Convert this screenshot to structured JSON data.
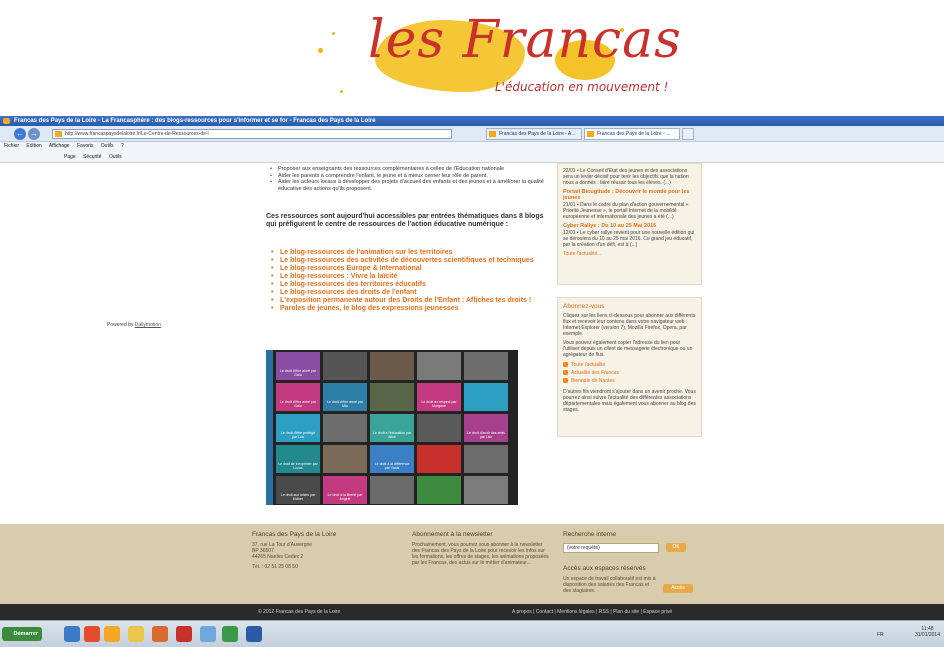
{
  "logo": {
    "brand": "les Francas",
    "tagline": "L'éducation en mouvement !"
  },
  "browser": {
    "title": "Francas des Pays de la Loire - La Francasphère : des blogs-ressources pour s'informer et se for - Francas des Pays de la Loire",
    "url": "http://www.francaspaysdelaloire.fr/Le-Centre-de-Ressources-de-l",
    "tabs": [
      {
        "label": "Francas des Pays de la Loire - A..."
      },
      {
        "label": "Francas des Pays de la Loire - ..."
      }
    ],
    "menu": [
      "Fichier",
      "Edition",
      "Affichage",
      "Favoris",
      "Outils",
      "?"
    ],
    "toolbar": [
      "Page",
      "Sécurité",
      "Outils"
    ]
  },
  "page": {
    "powered_by_prefix": "Powered by",
    "powered_by_link": "Dailymotion",
    "bullets": [
      "Proposer aux enseignants des ressources complémentaires à celles de l'Education nationale",
      "Aider les parents à comprendre l'enfant, le jeune et à mieux cerner leur rôle de parent.",
      "Aider les acteurs locaux à développer des projets d'accueil des enfants et des jeunes et à améliorer la qualité éducative des actions qu'ils proposent."
    ],
    "lead": "Ces ressources sont aujourd'hui accessibles par entrées thématiques dans 8 blogs qui préfigurent le centre de ressources de l'action éducative numérique :",
    "blog_links": [
      "Le blog-ressources de l'animation sur les territoires",
      "Le blog-ressources des activités de découvertes scientifiques et techniques",
      "Le blog-ressources Europe & International",
      "Le blog-ressources : Vivre la laïcité",
      "Le blog-ressources des territoires éducatifs",
      "Le blog-ressources des droits de l'enfant",
      "L'exposition permanente autour des Droits de l'Enfant : Affiches tes droits !",
      "Paroles de jeunes, le blog des expressions jeunesses"
    ],
    "video_brand": "Dailymotion",
    "video_tiles": [
      {
        "label": "Le droit d'être aimé",
        "by": "par Gaïa",
        "color": "#8a4fa3"
      },
      {
        "label": "",
        "by": "",
        "color": "#555"
      },
      {
        "label": "",
        "by": "",
        "color": "#6b5a48"
      },
      {
        "label": "",
        "by": "",
        "color": "#7a7a7a"
      },
      {
        "label": "",
        "by": "",
        "color": "#6d6d6d"
      },
      {
        "label": "Le droit d'être aimé",
        "by": "par Gaïa",
        "color": "#c23a7f"
      },
      {
        "label": "Le droit d'être aimé",
        "by": "par Mia",
        "color": "#2d7fa8"
      },
      {
        "label": "",
        "by": "",
        "color": "#596648"
      },
      {
        "label": "Le droit au respect",
        "by": "par Morgane",
        "color": "#c23a7f"
      },
      {
        "label": "",
        "by": "",
        "color": "#2d9fc2"
      },
      {
        "label": "Le droit d'être protégé",
        "by": "par Lou",
        "color": "#2d9fc2"
      },
      {
        "label": "",
        "by": "",
        "color": "#6d6d6d"
      },
      {
        "label": "Le droit à l'éducation",
        "by": "par Alice",
        "color": "#3aa39a"
      },
      {
        "label": "",
        "by": "",
        "color": "#5a5a5a"
      },
      {
        "label": "Le droit d'avoir des amis",
        "by": "par Lise",
        "color": "#a7418e"
      },
      {
        "label": "Le droit de s'exprimer",
        "by": "par Lucas",
        "color": "#23898f"
      },
      {
        "label": "",
        "by": "",
        "color": "#7b6a58"
      },
      {
        "label": "Le droit à la différence",
        "by": "par Yanis",
        "color": "#3b7fc4"
      },
      {
        "label": "",
        "by": "",
        "color": "#c8312b"
      },
      {
        "label": "",
        "by": "",
        "color": "#6d6d6d"
      },
      {
        "label": "Le droit aux loisirs",
        "by": "par Esther",
        "color": "#4a4a4a"
      },
      {
        "label": "Le droit à la liberté",
        "by": "par Angèle",
        "color": "#c23a7f"
      },
      {
        "label": "",
        "by": "",
        "color": "#6b6b6b"
      },
      {
        "label": "",
        "by": "",
        "color": "#3e8a3e"
      },
      {
        "label": "",
        "by": "",
        "color": "#7b7b7b"
      }
    ]
  },
  "sidebar": {
    "news": [
      {
        "title": "",
        "text": "22/01 • Le Conseil d'Etat des jeunes et des associations sera un levier décisif pour tenir les objectifs que la nation nous a donnés : faire réussir tous les élèves. (...)"
      },
      {
        "title": "Portail Biougitude : Découvrir le monde pour les jeunes",
        "text": "21/01 • Dans le cadre du plan d'action gouvernemental « Priorité Jeunesse », le portail Internet de la mobilité européenne et internationale des jeunes a été (...)"
      },
      {
        "title": "Cyber Rallye : Du 10 au 25 Mai 2016",
        "text": "12/01 • Le cyber rallye revient pour une nouvelle édition qui se déroulera du 10 au 25 mai 2016. Ce grand jeu éducatif, par la création d'un défi, est à (...)"
      }
    ],
    "news_all": "Toute l'actualité...",
    "abonnez_title": "Abonnez-vous",
    "abonnez_p1": "Cliquez sur les liens ci-dessous pour abonner aux différents flux et recevoir leur contenu dans votre navigateur web : Internet Explorer (version 7), Mozilla Firefox, Opera, par exemple.",
    "abonnez_p2": "Vous pouvez également copier l'adresse du lien pour l'utiliser depuis un client de messagerie électronique ou un agrégateur de flux.",
    "feeds": [
      "Toute l'actualité",
      "Actualité des Francas",
      "Biennale de Nantes"
    ],
    "abonnez_p3": "D'autres fils viendront s'ajouter dans un avenir proche. Vous pourrez ainsi suivre l'actualité des différentes associations départementales mais également vous abonner au blog des stages."
  },
  "footer": {
    "org": "Francas des Pays de la Loire",
    "address": [
      "37, rue La Tour d'Auvergne",
      "BP 36507",
      "44265 Nantes Cedex 2"
    ],
    "phone": "Tél. : 02 51 25 08 50",
    "newsletter_title": "Abonnement à la newsletter",
    "newsletter_text": "Prochainement, vous pourrez vous abonner à la newsletter des Francas des Pays de la Loire pour recevoir les infos sur les formations, les offres de stages, les animations proposées par les Francas, des actus sur le métier d'animateur...",
    "search_title": "Recherche interne",
    "search_value": "(votre requête)",
    "ok_label": "OK",
    "access_title": "Accès aux espaces réservés",
    "access_text": "Un espace de travail collaboratif est mis à disposition des salariés des Francas et des stagiaires.",
    "access_button": "Accès",
    "copyright": "© 2012 Francas des Pays de la Loire",
    "links": "A propos | Contact | Mentions légales | RSS | Plan du site | Espace privé"
  },
  "taskbar": {
    "start": "Démarrer",
    "lang": "FR",
    "time": "11:48",
    "date": "31/01/2014"
  }
}
